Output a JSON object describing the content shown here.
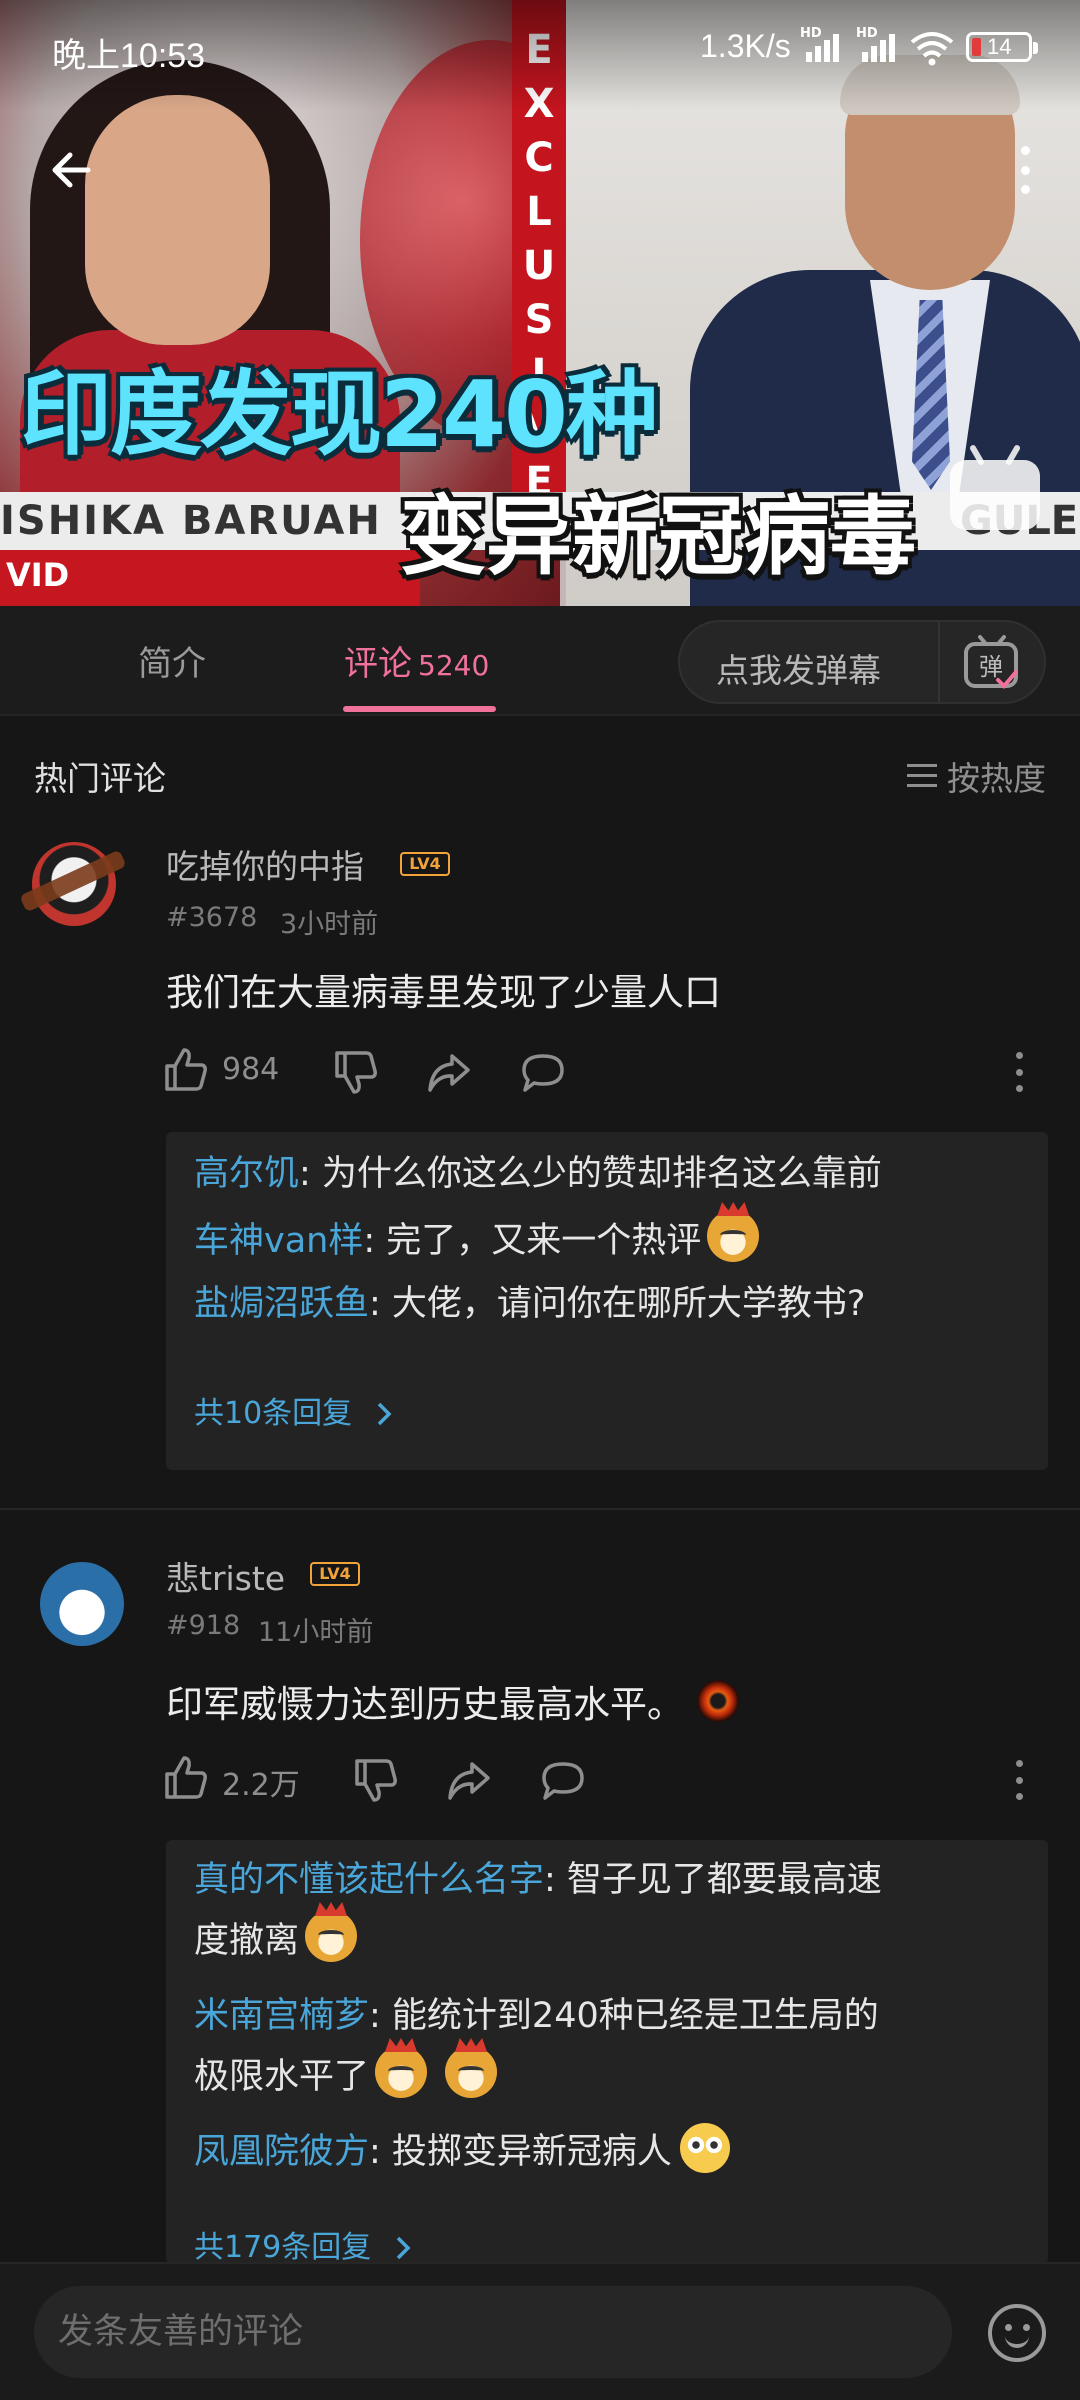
{
  "status_bar": {
    "time": "晚上10:53",
    "network_speed": "1.3K/s",
    "hd1": "HD",
    "hd2": "HD",
    "battery": "14"
  },
  "video": {
    "headline_line1": "印度发现240种",
    "headline_line2": "变异新冠病毒",
    "exclusive_text": [
      "E",
      "X",
      "C",
      "L",
      "U",
      "S",
      "I",
      "V",
      "E"
    ],
    "ticker_left": "ISHIKA BARUAH",
    "ticker_right": "GULE",
    "ticker_small": "VID",
    "back_icon": "arrow-left-icon",
    "more_icon": "kebab-icon"
  },
  "tabs": {
    "intro_label": "简介",
    "comments_label": "评论",
    "comments_count": "5240",
    "danmaku_placeholder": "点我发弹幕",
    "danmaku_icon": "弹"
  },
  "comments_header": {
    "title": "热门评论",
    "sort_label": "按热度"
  },
  "comments": [
    {
      "username": "吃掉你的中指",
      "level": "LV4",
      "floor": "#3678",
      "time": "3小时前",
      "text": "我们在大量病毒里发现了少量人口",
      "likes": "984",
      "replies": [
        {
          "who": "高尔饥",
          "text": ": 为什么你这么少的赞却排名这么靠前"
        },
        {
          "who": "车神van样",
          "text": ": 完了，又来一个热评"
        },
        {
          "who": "盐焗沼跃鱼",
          "text": ": 大佬，请问你在哪所大学教书?"
        }
      ],
      "more_replies": "共10条回复"
    },
    {
      "username": "悲triste",
      "level": "LV4",
      "floor": "#918",
      "time": "11小时前",
      "text": "印军威慑力达到历史最高水平。",
      "likes": "2.2万",
      "replies": [
        {
          "who": "真的不懂该起什么名字",
          "text": ": 智子见了都要最高速",
          "cont": "度撤离"
        },
        {
          "who": "米南宫楠芗",
          "text": ": 能统计到240种已经是卫生局的",
          "cont": "极限水平了"
        },
        {
          "who": "凤凰院彼方",
          "text": ": 投掷变异新冠病人"
        }
      ],
      "more_replies": "共179条回复"
    }
  ],
  "bottom_bar": {
    "input_placeholder": "发条友善的评论",
    "emoji_icon": "smile-icon"
  },
  "colors": {
    "accent_pink": "#f0719a",
    "link_blue": "#4aa6d8",
    "level_orange": "#f2a33a",
    "background": "#161616"
  }
}
